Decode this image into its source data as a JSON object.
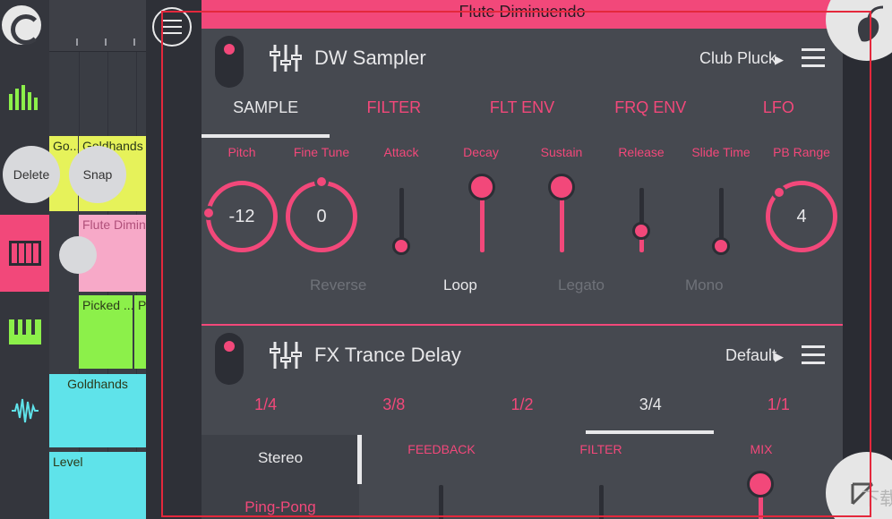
{
  "track_panel": {
    "bubbles": {
      "delete": "Delete",
      "snap": "Snap"
    },
    "patterns": [
      {
        "label": "Go...",
        "color": "#e6f25a"
      },
      {
        "label": "Goldhands",
        "color": "#e6f25a"
      },
      {
        "label": "Flute Dimin",
        "color": "#f7a9c8"
      },
      {
        "label": "Picked ...",
        "color": "#8cf04a"
      },
      {
        "label": "P",
        "color": "#8cf04a"
      },
      {
        "label": "Goldhands",
        "color": "#5fe3ea"
      },
      {
        "label": "Level",
        "color": "#5fe3ea"
      }
    ]
  },
  "window": {
    "title": "Flute Diminuendo"
  },
  "instrument": {
    "name": "DW Sampler",
    "preset": "Club Pluck",
    "tabs": [
      {
        "label": "SAMPLE",
        "active": true
      },
      {
        "label": "FILTER",
        "active": false
      },
      {
        "label": "FLT ENV",
        "active": false
      },
      {
        "label": "FRQ ENV",
        "active": false
      },
      {
        "label": "LFO",
        "active": false
      }
    ],
    "params": {
      "pitch": {
        "label": "Pitch",
        "value": "-12"
      },
      "fine_tune": {
        "label": "Fine Tune",
        "value": "0"
      },
      "attack": {
        "label": "Attack",
        "level": 0.0
      },
      "decay": {
        "label": "Decay",
        "level": 0.85
      },
      "sustain": {
        "label": "Sustain",
        "level": 0.85
      },
      "release": {
        "label": "Release",
        "level": 0.15
      },
      "slide_time": {
        "label": "Slide Time",
        "level": 0.0
      },
      "pb_range": {
        "label": "PB Range",
        "value": "4"
      }
    },
    "toggles": [
      {
        "label": "Reverse",
        "on": false
      },
      {
        "label": "Loop",
        "on": true
      },
      {
        "label": "Legato",
        "on": false
      },
      {
        "label": "Mono",
        "on": false
      }
    ]
  },
  "effect": {
    "name": "FX Trance Delay",
    "preset": "Default",
    "tabs": [
      {
        "label": "1/4",
        "active": false
      },
      {
        "label": "3/8",
        "active": false
      },
      {
        "label": "1/2",
        "active": false
      },
      {
        "label": "3/4",
        "active": true
      },
      {
        "label": "1/1",
        "active": false
      }
    ],
    "modes": [
      {
        "label": "Stereo",
        "active": false
      },
      {
        "label": "Ping-Pong",
        "active": true
      }
    ],
    "params": {
      "feedback": {
        "label": "FEEDBACK"
      },
      "filter": {
        "label": "FILTER"
      },
      "mix": {
        "label": "MIX",
        "level": 1.0
      }
    }
  },
  "colors": {
    "accent": "#f2487a",
    "panel": "#464950",
    "text": "#e8e8ea"
  },
  "watermark": "下载"
}
